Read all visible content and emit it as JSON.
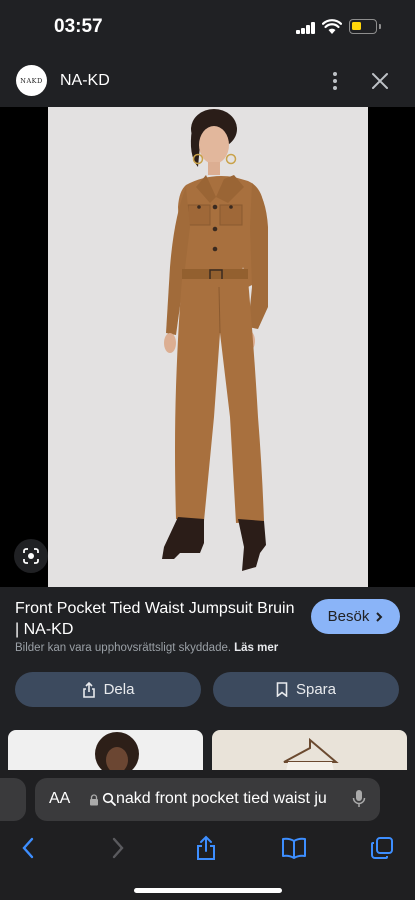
{
  "status_bar": {
    "time": "03:57"
  },
  "header": {
    "logo_text": "NAKD",
    "site_name": "NA-KD"
  },
  "product": {
    "title": "Front Pocket Tied Waist Jumpsuit Bruin | NA-KD",
    "visit_label": "Besök",
    "copyright_text": "Bilder kan vara upphovsrättsligt skyddade.",
    "read_more_label": "Läs mer"
  },
  "actions": {
    "share_label": "Dela",
    "save_label": "Spara"
  },
  "safari": {
    "aa_label": "AA",
    "url_text": "nakd front pocket tied waist ju"
  },
  "colors": {
    "accent": "#8ab4f8",
    "jumpsuit": "#a8703e",
    "background": "#202124"
  }
}
